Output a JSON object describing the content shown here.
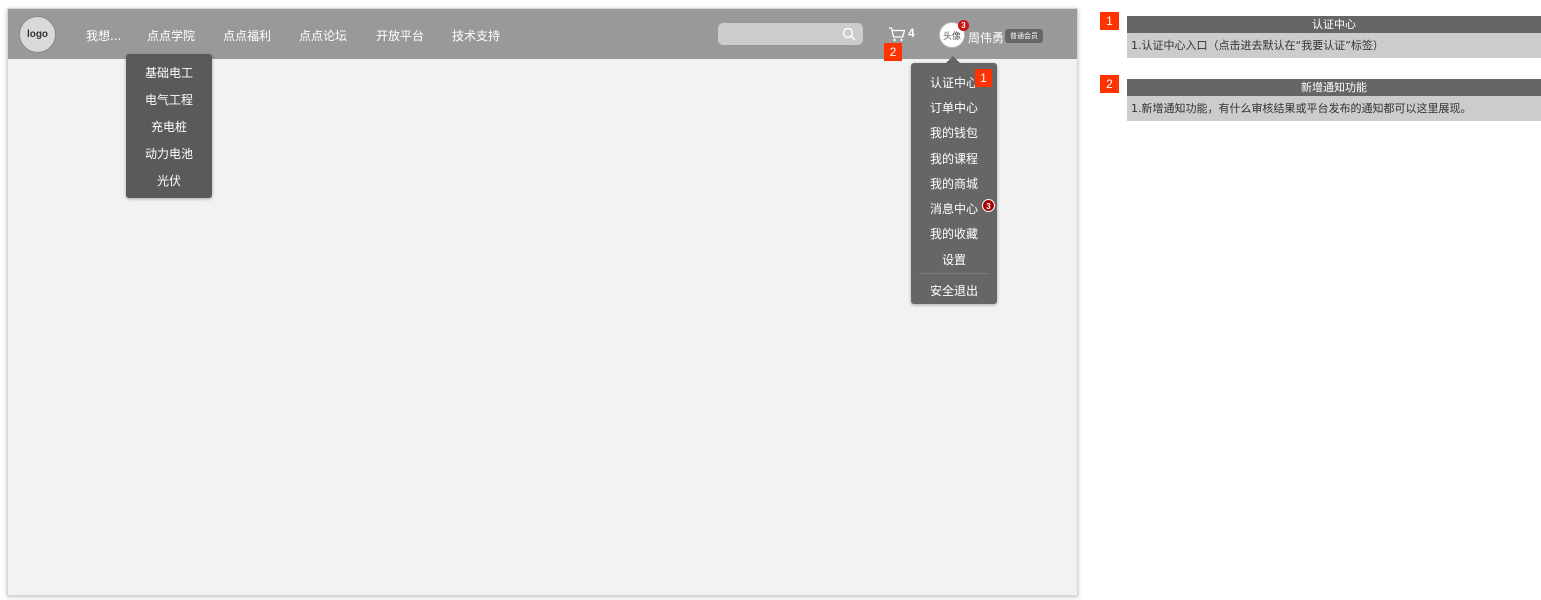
{
  "header": {
    "logo_text": "logo",
    "nav": [
      {
        "label": "我想..."
      },
      {
        "label": "点点学院"
      },
      {
        "label": "点点福利"
      },
      {
        "label": "点点论坛"
      },
      {
        "label": "开放平台"
      },
      {
        "label": "技术支持"
      }
    ],
    "search": {
      "placeholder": "",
      "value": ""
    },
    "cart": {
      "count": "4"
    },
    "user": {
      "avatar_text": "头像",
      "avatar_badge": "3",
      "name": "周伟勇",
      "member_tag": "普通会员"
    }
  },
  "academy_menu": {
    "items": [
      "基础电工",
      "电气工程",
      "充电桩",
      "动力电池",
      "光伏"
    ]
  },
  "user_menu": {
    "items": [
      "认证中心",
      "订单中心",
      "我的钱包",
      "我的课程",
      "我的商城",
      "消息中心",
      "我的收藏",
      "设置",
      "安全退出"
    ],
    "message_badge": "3"
  },
  "markers": {
    "m1": "1",
    "m2": "2"
  },
  "notes": [
    {
      "num": "1",
      "title": "认证中心",
      "body": "1.认证中心入口（点击进去默认在“我要认证”标签）"
    },
    {
      "num": "2",
      "title": "新增通知功能",
      "body": "1.新增通知功能，有什么审核结果或平台发布的通知都可以这里展现。"
    }
  ],
  "colors": {
    "topbar": "#999999",
    "dropdown": "#5a5a5a",
    "marker": "#ff3300",
    "badge": "#cc1111"
  }
}
